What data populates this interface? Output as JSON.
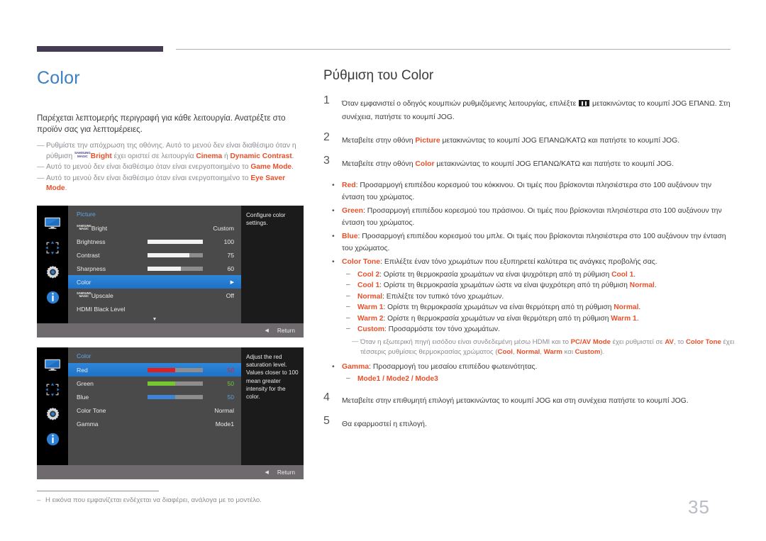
{
  "header": {
    "tab_color": "#453c53"
  },
  "page_number": "35",
  "left": {
    "chapter_title": "Color",
    "intro": "Παρέχεται λεπτομερής περιγραφή για κάθε λειτουργία. Ανατρέξτε στο προϊόν σας για λεπτομέρειες.",
    "notes": [
      {
        "pre": "Ρυθμίστε την απόχρωση της οθόνης. Αυτό το μενού δεν είναι διαθέσιμο όταν η ρύθμιση ",
        "magic": "SAMSUNG MAGIC",
        "magic_suffix": "Bright",
        "mid": " έχει οριστεί σε λειτουργία ",
        "hl1": "Cinema",
        "mid2": " ή ",
        "hl2": "Dynamic Contrast",
        "post": "."
      },
      {
        "pre": "Αυτό το μενού δεν είναι διαθέσιμο όταν είναι ενεργοποιημένο το ",
        "hl1": "Game Mode",
        "post": "."
      },
      {
        "pre": "Αυτό το μενού δεν είναι διαθέσιμο όταν είναι ενεργοποιημένο το ",
        "hl1": "Eye Saver Mode",
        "post": "."
      }
    ],
    "footnote": "Η εικόνα που εμφανίζεται ενδέχεται να διαφέρει, ανάλογα με το μοντέλο."
  },
  "osd1": {
    "title": "Picture",
    "description": "Configure color settings.",
    "return_label": "Return",
    "rail_icons": [
      "monitor-icon",
      "dpad-icon",
      "gear-icon",
      "info-icon"
    ],
    "rows": [
      {
        "label_magic": "SAMSUNG MAGIC",
        "label": "Bright",
        "value": "Custom",
        "type": "value"
      },
      {
        "label": "Brightness",
        "value": "100",
        "type": "slider",
        "fill": 100,
        "color": "white"
      },
      {
        "label": "Contrast",
        "value": "75",
        "type": "slider",
        "fill": 75,
        "color": "white"
      },
      {
        "label": "Sharpness",
        "value": "60",
        "type": "slider",
        "fill": 60,
        "color": "white"
      },
      {
        "label": "Color",
        "value": "▶",
        "type": "arrow",
        "selected": true
      },
      {
        "label_magic": "SAMSUNG MAGIC",
        "label": "Upscale",
        "value": "Off",
        "type": "value"
      },
      {
        "label": "HDMI Black Level",
        "value": "",
        "type": "value"
      }
    ]
  },
  "osd2": {
    "title": "Color",
    "description": "Adjust the red saturation level. Values closer to 100 mean greater intensity for the color.",
    "return_label": "Return",
    "rail_icons": [
      "monitor-icon",
      "dpad-icon",
      "gear-icon",
      "info-icon"
    ],
    "rows": [
      {
        "label": "Red",
        "value": "50",
        "type": "slider",
        "fill": 50,
        "color": "red",
        "selected": true
      },
      {
        "label": "Green",
        "value": "50",
        "type": "slider",
        "fill": 50,
        "color": "green"
      },
      {
        "label": "Blue",
        "value": "50",
        "type": "slider",
        "fill": 50,
        "color": "blue"
      },
      {
        "label": "Color Tone",
        "value": "Normal",
        "type": "value"
      },
      {
        "label": "Gamma",
        "value": "Mode1",
        "type": "value"
      }
    ]
  },
  "right": {
    "section_title": "Ρύθμιση του Color",
    "steps": [
      {
        "num": "1",
        "pre": "Όταν εμφανιστεί ο οδηγός κουμπιών ρυθμιζόμενης λειτουργίας, επιλέξτε ",
        "icon": "jog-menu-icon",
        "post": " μετακινώντας το κουμπί JOG ΕΠΑΝΩ. Στη συνέχεια, πατήστε το κουμπί JOG."
      },
      {
        "num": "2",
        "pre": "Μεταβείτε στην οθόνη ",
        "hl": "Picture",
        "post": " μετακινώντας το κουμπί JOG ΕΠΑΝΩ/ΚΑΤΩ και πατήστε το κουμπί JOG."
      },
      {
        "num": "3",
        "pre": "Μεταβείτε στην οθόνη ",
        "hl": "Color",
        "post": " μετακινώντας το κουμπί JOG ΕΠΑΝΩ/ΚΑΤΩ και πατήστε το κουμπί JOG."
      }
    ],
    "bullets": [
      {
        "term": "Red",
        "text": ": Προσαρμογή επιπέδου κορεσμού του κόκκινου. Οι τιμές που βρίσκονται πλησιέστερα στο 100 αυξάνουν την ένταση του χρώματος."
      },
      {
        "term": "Green",
        "text": ": Προσαρμογή επιπέδου κορεσμού του πράσινου. Οι τιμές που βρίσκονται πλησιέστερα στο 100 αυξάνουν την ένταση του χρώματος."
      },
      {
        "term": "Blue",
        "text": ": Προσαρμογή επιπέδου κορεσμού του μπλε. Οι τιμές που βρίσκονται πλησιέστερα στο 100 αυξάνουν την ένταση του χρώματος."
      }
    ],
    "color_tone": {
      "term": "Color Tone",
      "text": ": Επιλέξτε έναν τόνο χρωμάτων που εξυπηρετεί καλύτερα τις ανάγκες προβολής σας.",
      "subs": [
        {
          "term": "Cool 2",
          "pre": ": Ορίστε τη θερμοκρασία χρωμάτων να είναι ψυχρότερη από τη ρύθμιση ",
          "ref": "Cool 1",
          "post": "."
        },
        {
          "term": "Cool 1",
          "pre": ": Ορίστε τη θερμοκρασία χρωμάτων ώστε να είναι ψυχρότερη από τη ρύθμιση ",
          "ref": "Normal",
          "post": "."
        },
        {
          "term": "Normal",
          "pre": ": Επιλέξτε τον τυπικό τόνο χρωμάτων.",
          "ref": "",
          "post": ""
        },
        {
          "term": "Warm 1",
          "pre": ": Ορίστε τη θερμοκρασία χρωμάτων να είναι θερμότερη από τη ρύθμιση ",
          "ref": "Normal",
          "post": "."
        },
        {
          "term": "Warm 2",
          "pre": ": Ορίστε η θερμοκρασία χρωμάτων να είναι θερμότερη από τη ρύθμιση ",
          "ref": "Warm 1",
          "post": "."
        },
        {
          "term": "Custom",
          "pre": ": Προσαρμόστε τον τόνο χρωμάτων.",
          "ref": "",
          "post": ""
        }
      ],
      "note": {
        "p1": "Όταν η εξωτερική πηγή εισόδου είναι συνδεδεμένη μέσω HDMI και το ",
        "h1": "PC/AV Mode",
        "p2": " έχει ρυθμιστεί σε ",
        "h2": "AV",
        "p3": ", το ",
        "h3": "Color Tone",
        "p4": " έχει τέσσερις ρυθμίσεις θερμοκρασίας χρώματος (",
        "h4": "Cool",
        "p5": ", ",
        "h5": "Normal",
        "p6": ", ",
        "h6": "Warm",
        "p7": " και ",
        "h7": "Custom",
        "p8": ")."
      }
    },
    "gamma": {
      "term": "Gamma",
      "text": ": Προσαρμογή του μεσαίου επιπέδου φωτεινότητας.",
      "modes": [
        "Mode1",
        "Mode2",
        "Mode3"
      ],
      "separator": " / "
    },
    "steps_tail": [
      {
        "num": "4",
        "text": "Μεταβείτε στην επιθυμητή επιλογή μετακινώντας το κουμπί JOG και στη συνέχεια πατήστε το κουμπί JOG."
      },
      {
        "num": "5",
        "text": "Θα εφαρμοστεί η επιλογή."
      }
    ]
  }
}
